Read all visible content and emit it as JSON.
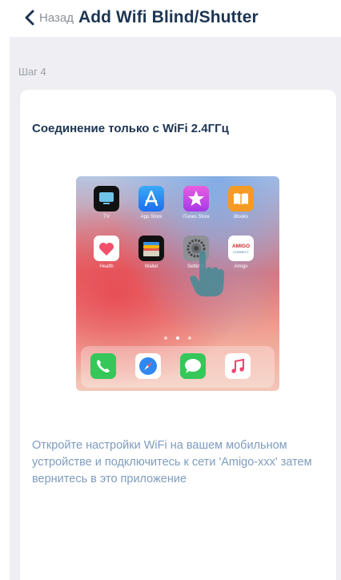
{
  "header": {
    "back_label": "Назад",
    "title": "Add Wifi Blind/Shutter"
  },
  "step_label": "Шаг 4",
  "card": {
    "title": "Соединение только с WiFi 2.4ГГц",
    "description": "Откройте настройки WiFi на вашем мобильном устройстве и подключитесь к сети 'Amigo-xxx' затем вернитесь в это приложение"
  },
  "illustration": {
    "apps": [
      {
        "label": "TV",
        "icon": "tv-icon"
      },
      {
        "label": "App Store",
        "icon": "app-store-icon"
      },
      {
        "label": "iTunes Store",
        "icon": "itunes-store-icon"
      },
      {
        "label": "iBooks",
        "icon": "ibooks-icon"
      },
      {
        "label": "Health",
        "icon": "health-icon"
      },
      {
        "label": "Wallet",
        "icon": "wallet-icon"
      },
      {
        "label": "Settings",
        "icon": "settings-icon"
      },
      {
        "label": "Amigo",
        "icon": "amigo-icon"
      }
    ],
    "amigo_logo_top": "AMIGO",
    "amigo_logo_bottom": "CONNECT",
    "dock": [
      "phone-icon",
      "safari-icon",
      "messages-icon",
      "music-icon"
    ],
    "colors": {
      "accent": "#1c3553",
      "description": "#7f9cbe",
      "background": "#efeff3"
    }
  }
}
